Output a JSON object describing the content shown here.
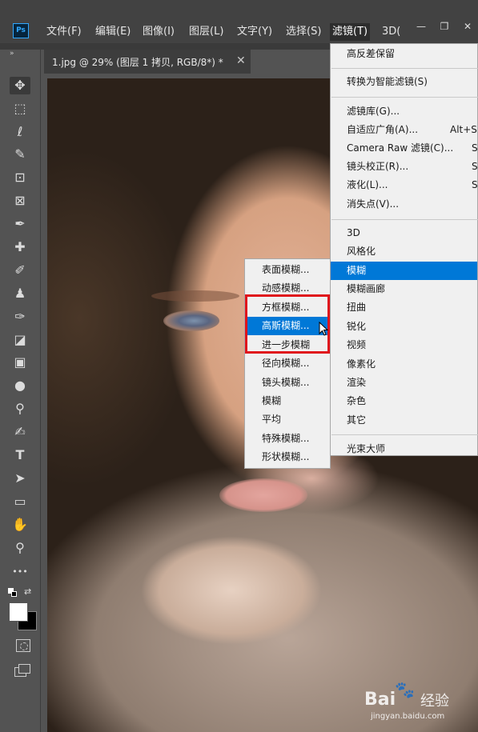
{
  "app": {
    "logo": "Ps"
  },
  "menubar": {
    "items": [
      "文件(F)",
      "编辑(E)",
      "图像(I)",
      "图层(L)",
      "文字(Y)",
      "选择(S)",
      "滤镜(T)",
      "3D("
    ],
    "active_index": 6,
    "window_controls": {
      "minimize": "—",
      "restore": "❐",
      "close": "✕"
    }
  },
  "toolbar": {
    "collapse_glyph": "»",
    "tools": [
      {
        "icon": "move-tool-icon",
        "glyph": "✥"
      },
      {
        "icon": "marquee-tool-icon",
        "glyph": "⬚"
      },
      {
        "icon": "lasso-tool-icon",
        "glyph": "ℓ"
      },
      {
        "icon": "quick-selection-tool-icon",
        "glyph": "✎"
      },
      {
        "icon": "crop-tool-icon",
        "glyph": "⊡"
      },
      {
        "icon": "frame-tool-icon",
        "glyph": "⊠"
      },
      {
        "icon": "eyedropper-tool-icon",
        "glyph": "✒"
      },
      {
        "icon": "healing-brush-tool-icon",
        "glyph": "✚"
      },
      {
        "icon": "brush-tool-icon",
        "glyph": "✐"
      },
      {
        "icon": "clone-stamp-tool-icon",
        "glyph": "♟"
      },
      {
        "icon": "history-brush-tool-icon",
        "glyph": "✑"
      },
      {
        "icon": "eraser-tool-icon",
        "glyph": "◪"
      },
      {
        "icon": "gradient-tool-icon",
        "glyph": "▣"
      },
      {
        "icon": "blur-tool-icon",
        "glyph": "●"
      },
      {
        "icon": "dodge-tool-icon",
        "glyph": "⚲"
      },
      {
        "icon": "pen-tool-icon",
        "glyph": "✍"
      },
      {
        "icon": "type-tool-icon",
        "glyph": "T"
      },
      {
        "icon": "path-selection-tool-icon",
        "glyph": "➤"
      },
      {
        "icon": "rectangle-tool-icon",
        "glyph": "▭"
      },
      {
        "icon": "hand-tool-icon",
        "glyph": "✋"
      },
      {
        "icon": "zoom-tool-icon",
        "glyph": "⚲"
      },
      {
        "icon": "more-tools-icon",
        "glyph": "•••"
      }
    ],
    "colors": {
      "foreground": "#ffffff",
      "background": "#000000"
    }
  },
  "document_tab": {
    "title": "1.jpg @ 29% (图层 1 拷贝, RGB/8*) *",
    "close_glyph": "✕"
  },
  "filter_menu": {
    "items": [
      {
        "label": "高反差保留",
        "shortcut": ""
      },
      {
        "label": "转换为智能滤镜(S)",
        "shortcut": ""
      },
      {
        "label": "滤镜库(G)...",
        "shortcut": ""
      },
      {
        "label": "自适应广角(A)...",
        "shortcut": "Alt+S"
      },
      {
        "label": "Camera Raw 滤镜(C)...",
        "shortcut": "S"
      },
      {
        "label": "镜头校正(R)...",
        "shortcut": "S"
      },
      {
        "label": "液化(L)...",
        "shortcut": "S"
      },
      {
        "label": "消失点(V)...",
        "shortcut": ""
      },
      {
        "label": "3D",
        "shortcut": ""
      },
      {
        "label": "风格化",
        "shortcut": ""
      },
      {
        "label": "模糊",
        "shortcut": ""
      },
      {
        "label": "模糊画廊",
        "shortcut": ""
      },
      {
        "label": "扭曲",
        "shortcut": ""
      },
      {
        "label": "锐化",
        "shortcut": ""
      },
      {
        "label": "视频",
        "shortcut": ""
      },
      {
        "label": "像素化",
        "shortcut": ""
      },
      {
        "label": "渲染",
        "shortcut": ""
      },
      {
        "label": "杂色",
        "shortcut": ""
      },
      {
        "label": "其它",
        "shortcut": ""
      },
      {
        "label": "光束大师",
        "shortcut": ""
      }
    ],
    "highlighted_index": 10
  },
  "blur_submenu": {
    "items": [
      "表面模糊...",
      "动感模糊...",
      "方框模糊...",
      "高斯模糊...",
      "进一步模糊",
      "径向模糊...",
      "镜头模糊...",
      "模糊",
      "平均",
      "特殊模糊...",
      "形状模糊..."
    ],
    "highlighted_index": 3
  },
  "annotation": {
    "color": "#e0141c"
  },
  "watermark": {
    "brand": "Bai",
    "paw": "🐾",
    "jingyan": "经验",
    "url": "jingyan.baidu.com"
  }
}
